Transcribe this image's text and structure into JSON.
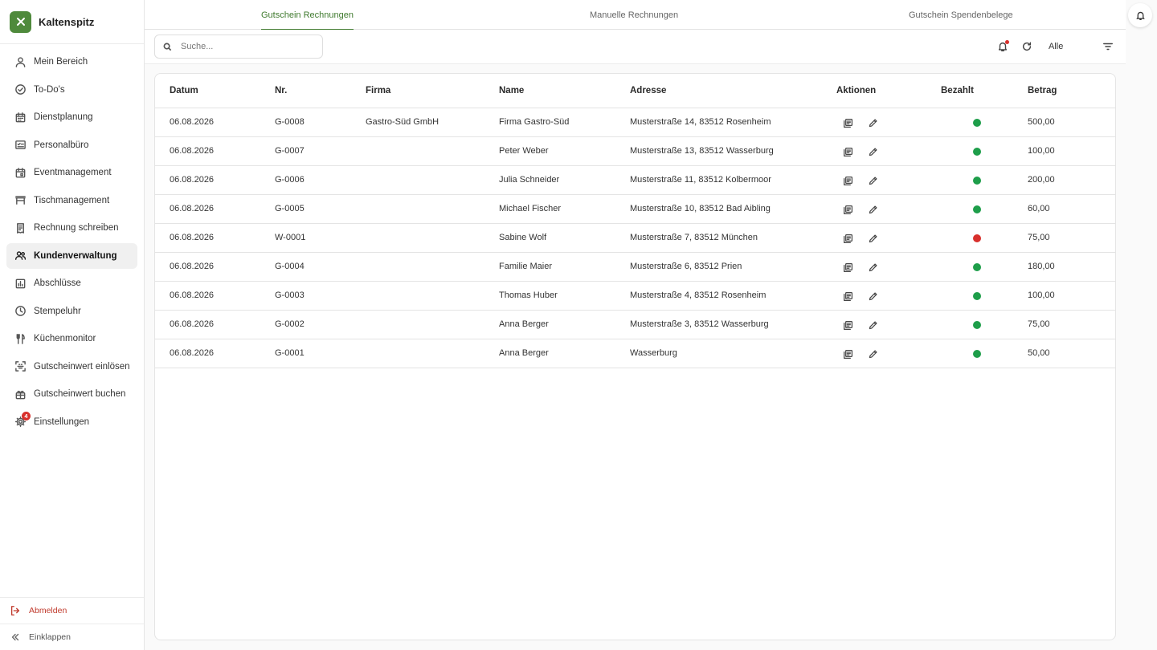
{
  "brand": {
    "name": "Kaltenspitz",
    "logo_icon": "x-icon"
  },
  "sidebar": {
    "items": [
      {
        "label": "Mein Bereich",
        "icon": "user-icon",
        "active": false
      },
      {
        "label": "To-Do's",
        "icon": "check-circle-icon",
        "active": false
      },
      {
        "label": "Dienstplanung",
        "icon": "calendar-icon",
        "active": false
      },
      {
        "label": "Personalbüro",
        "icon": "id-card-icon",
        "active": false
      },
      {
        "label": "Eventmanagement",
        "icon": "calendar-event-icon",
        "active": false
      },
      {
        "label": "Tischmanagement",
        "icon": "table-icon",
        "active": false
      },
      {
        "label": "Rechnung schreiben",
        "icon": "receipt-icon",
        "active": false
      },
      {
        "label": "Kundenverwaltung",
        "icon": "users-icon",
        "active": true
      },
      {
        "label": "Abschlüsse",
        "icon": "bar-chart-icon",
        "active": false
      },
      {
        "label": "Stempeluhr",
        "icon": "clock-icon",
        "active": false
      },
      {
        "label": "Küchenmonitor",
        "icon": "utensils-icon",
        "active": false
      },
      {
        "label": "Gutscheinwert einlösen",
        "icon": "scan-icon",
        "active": false
      },
      {
        "label": "Gutscheinwert buchen",
        "icon": "gift-icon",
        "active": false
      },
      {
        "label": "Einstellungen",
        "icon": "gear-icon",
        "active": false,
        "badge": "4"
      }
    ],
    "logout_label": "Abmelden",
    "collapse_label": "Einklappen"
  },
  "tabs": [
    {
      "label": "Gutschein Rechnungen",
      "active": true
    },
    {
      "label": "Manuelle Rechnungen",
      "active": false
    },
    {
      "label": "Gutschein Spendenbelege",
      "active": false
    }
  ],
  "toolbar": {
    "search_placeholder": "Suche...",
    "filter_value": "Alle"
  },
  "colors": {
    "accent": "#3f7a2e",
    "paid": "#1e9e4a",
    "unpaid": "#d8302c"
  },
  "table": {
    "columns": [
      "Datum",
      "Nr.",
      "Firma",
      "Name",
      "Adresse",
      "Aktionen",
      "Bezahlt",
      "Betrag"
    ],
    "rows": [
      {
        "datum": "06.08.2026",
        "nr": "G-0008",
        "firma": "Gastro-Süd GmbH",
        "name": "Firma Gastro-Süd",
        "adresse": "Musterstraße 14, 83512 Rosenheim",
        "bezahlt": true,
        "betrag": "500,00"
      },
      {
        "datum": "06.08.2026",
        "nr": "G-0007",
        "firma": "",
        "name": "Peter Weber",
        "adresse": "Musterstraße 13, 83512 Wasserburg",
        "bezahlt": true,
        "betrag": "100,00"
      },
      {
        "datum": "06.08.2026",
        "nr": "G-0006",
        "firma": "",
        "name": "Julia Schneider",
        "adresse": "Musterstraße 11, 83512 Kolbermoor",
        "bezahlt": true,
        "betrag": "200,00"
      },
      {
        "datum": "06.08.2026",
        "nr": "G-0005",
        "firma": "",
        "name": "Michael Fischer",
        "adresse": "Musterstraße 10, 83512 Bad Aibling",
        "bezahlt": true,
        "betrag": "60,00"
      },
      {
        "datum": "06.08.2026",
        "nr": "W-0001",
        "firma": "",
        "name": "Sabine Wolf",
        "adresse": "Musterstraße 7, 83512 München",
        "bezahlt": false,
        "betrag": "75,00"
      },
      {
        "datum": "06.08.2026",
        "nr": "G-0004",
        "firma": "",
        "name": "Familie Maier",
        "adresse": "Musterstraße 6, 83512 Prien",
        "bezahlt": true,
        "betrag": "180,00"
      },
      {
        "datum": "06.08.2026",
        "nr": "G-0003",
        "firma": "",
        "name": "Thomas Huber",
        "adresse": "Musterstraße 4, 83512 Rosenheim",
        "bezahlt": true,
        "betrag": "100,00"
      },
      {
        "datum": "06.08.2026",
        "nr": "G-0002",
        "firma": "",
        "name": "Anna Berger",
        "adresse": "Musterstraße 3, 83512 Wasserburg",
        "bezahlt": true,
        "betrag": "75,00"
      },
      {
        "datum": "06.08.2026",
        "nr": "G-0001",
        "firma": "",
        "name": "Anna Berger",
        "adresse": "Wasserburg",
        "bezahlt": true,
        "betrag": "50,00"
      }
    ]
  }
}
